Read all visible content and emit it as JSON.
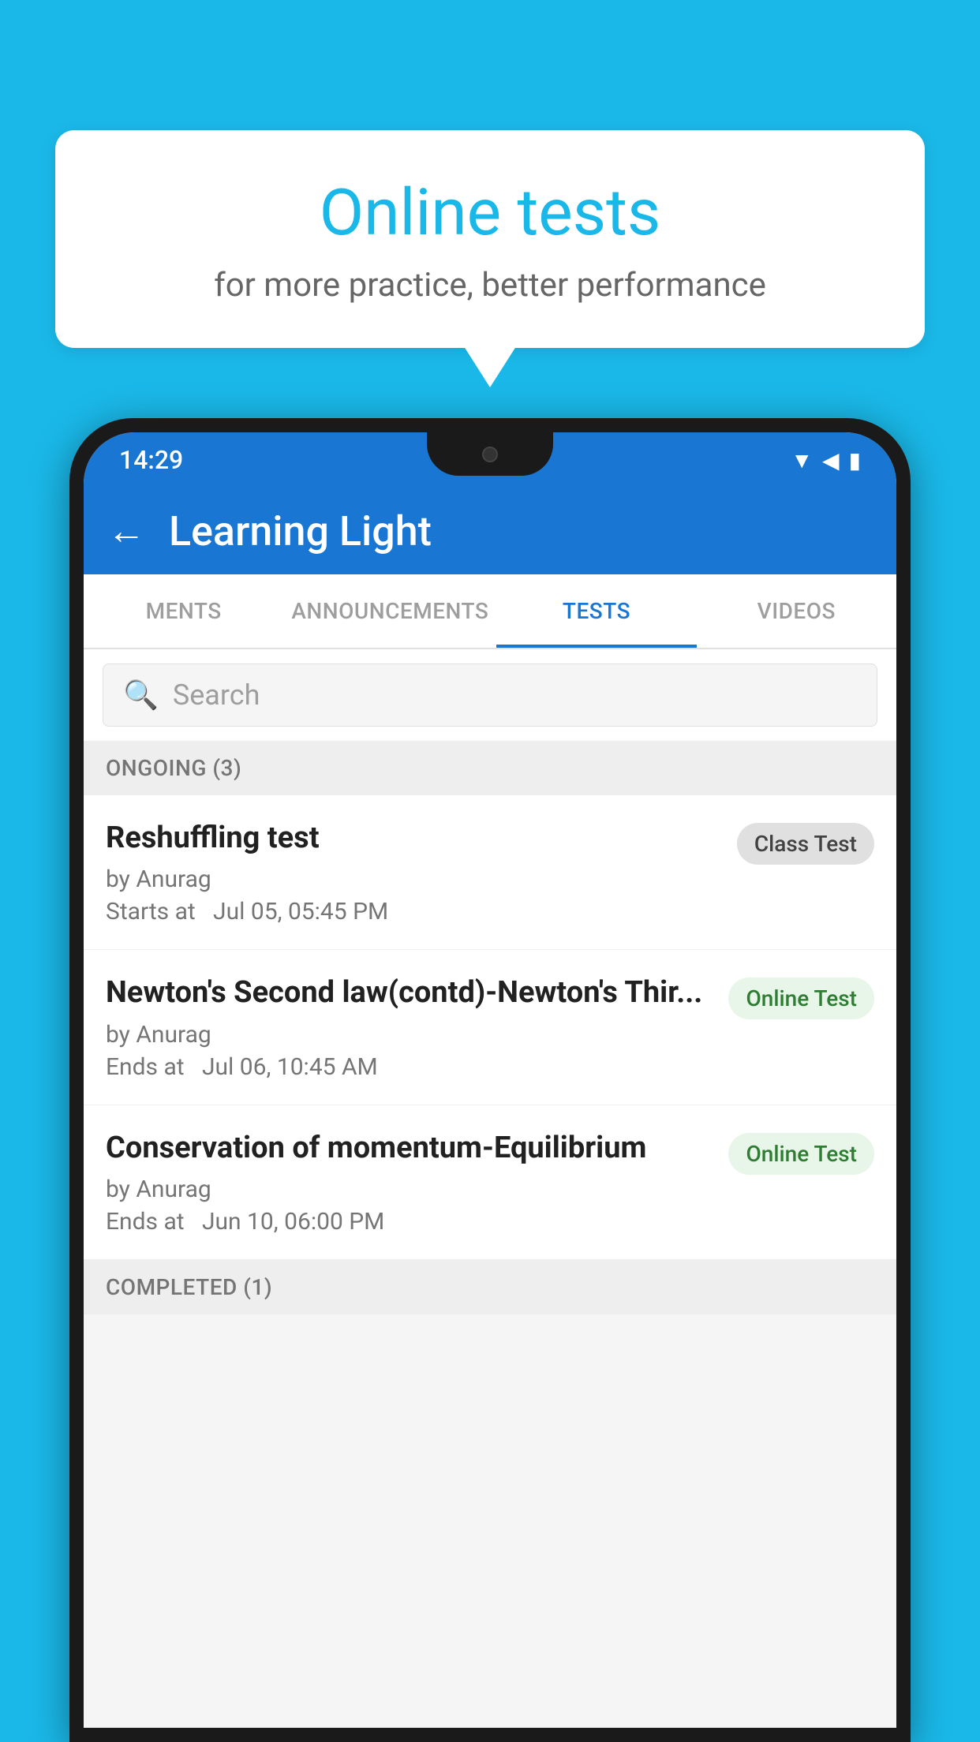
{
  "background_color": "#1ab8e8",
  "speech_bubble": {
    "title": "Online tests",
    "subtitle": "for more practice, better performance"
  },
  "status_bar": {
    "time": "14:29",
    "icons": [
      "wifi",
      "signal",
      "battery"
    ]
  },
  "app_bar": {
    "back_label": "←",
    "title": "Learning Light"
  },
  "tabs": [
    {
      "label": "MENTS",
      "active": false
    },
    {
      "label": "ANNOUNCEMENTS",
      "active": false
    },
    {
      "label": "TESTS",
      "active": true
    },
    {
      "label": "VIDEOS",
      "active": false
    }
  ],
  "search": {
    "placeholder": "Search"
  },
  "ongoing_section": {
    "header": "ONGOING (3)",
    "items": [
      {
        "title": "Reshuffling test",
        "author": "by Anurag",
        "time_label": "Starts at",
        "time_value": "Jul 05, 05:45 PM",
        "badge": "Class Test",
        "badge_type": "class"
      },
      {
        "title": "Newton's Second law(contd)-Newton's Thir...",
        "author": "by Anurag",
        "time_label": "Ends at",
        "time_value": "Jul 06, 10:45 AM",
        "badge": "Online Test",
        "badge_type": "online"
      },
      {
        "title": "Conservation of momentum-Equilibrium",
        "author": "by Anurag",
        "time_label": "Ends at",
        "time_value": "Jun 10, 06:00 PM",
        "badge": "Online Test",
        "badge_type": "online"
      }
    ]
  },
  "completed_section": {
    "header": "COMPLETED (1)"
  }
}
